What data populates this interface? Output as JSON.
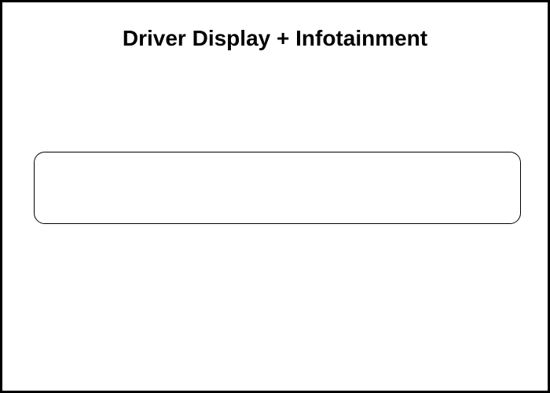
{
  "title": "Driver Display + Infotainment"
}
